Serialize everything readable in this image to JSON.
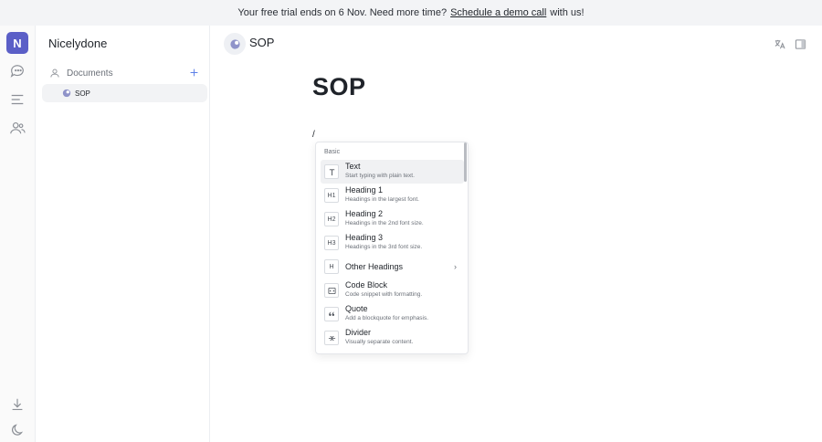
{
  "banner": {
    "text_before": "Your free trial ends on 6 Nov. Need more time?",
    "link": "Schedule a demo call",
    "text_after": "with us!"
  },
  "rail": {
    "logo_letter": "N",
    "icons": [
      "chat-icon",
      "menu-lines-icon",
      "people-icon",
      "download-icon",
      "moon-icon"
    ]
  },
  "sidebar": {
    "workspace_name": "Nicelydone",
    "documents_label": "Documents",
    "items": [
      {
        "label": "SOP"
      }
    ]
  },
  "header": {
    "title": "SOP"
  },
  "document": {
    "title": "SOP",
    "slash": "/"
  },
  "slash_menu": {
    "section": "Basic",
    "items": [
      {
        "icon": "T",
        "title": "Text",
        "desc": "Start typing with plain text."
      },
      {
        "icon": "H1",
        "title": "Heading 1",
        "desc": "Headings in the largest font."
      },
      {
        "icon": "H2",
        "title": "Heading 2",
        "desc": "Headings in the 2nd font size."
      },
      {
        "icon": "H3",
        "title": "Heading 3",
        "desc": "Headings in the 3rd font size."
      },
      {
        "icon": "H",
        "title": "Other Headings",
        "desc": ""
      },
      {
        "icon": "code",
        "title": "Code Block",
        "desc": "Code snippet with formatting."
      },
      {
        "icon": "quote",
        "title": "Quote",
        "desc": "Add a blockquote for emphasis."
      },
      {
        "icon": "divider",
        "title": "Divider",
        "desc": "Visually separate content."
      }
    ]
  },
  "colors": {
    "accent": "#5b5fc7",
    "link_plus": "#5b7fe8"
  }
}
